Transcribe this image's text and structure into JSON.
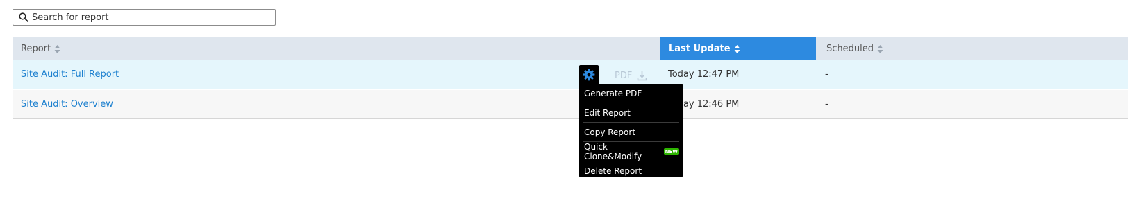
{
  "search": {
    "placeholder": "Search for report",
    "value": ""
  },
  "table": {
    "columns": [
      {
        "label": "Report"
      },
      {
        "label": "Last Update",
        "active": true
      },
      {
        "label": "Scheduled"
      }
    ],
    "rows": [
      {
        "name": "Site Audit: Full Report",
        "last_update": "Today 12:47 PM",
        "scheduled": "-"
      },
      {
        "name": "Site Audit: Overview",
        "last_update": "Today 12:46 PM",
        "scheduled": "-"
      }
    ]
  },
  "row_actions": {
    "pdf_label": "PDF",
    "gear_icon": "gear-icon",
    "download_icon": "download-icon"
  },
  "menu": {
    "items": [
      {
        "label": "Generate PDF"
      },
      {
        "label": "Edit Report"
      },
      {
        "label": "Copy Report"
      },
      {
        "label": "Quick Clone&Modify",
        "badge": "NEW"
      },
      {
        "label": "Delete Report"
      }
    ]
  },
  "colors": {
    "accent": "#2d8ae0",
    "link": "#1d80cf",
    "header_bg": "#dfe6ee",
    "selected_row_bg": "#e5f6fc",
    "new_badge": "#2db400"
  }
}
